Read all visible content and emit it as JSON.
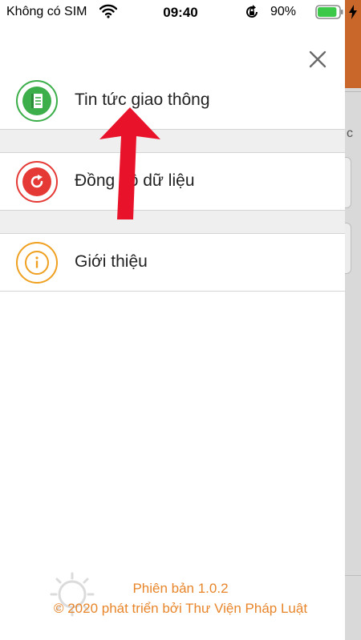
{
  "status_bar": {
    "carrier": "Không có SIM",
    "time": "09:40",
    "battery_percent": "90%",
    "battery_level": 0.9
  },
  "underlay": {
    "partial_char": "c"
  },
  "menu": {
    "items": [
      {
        "label": "Tin tức giao thông",
        "icon": "news-book-icon",
        "color": "#3cae4a"
      },
      {
        "label": "Đồng bộ dữ liệu",
        "icon": "sync-icon",
        "color": "#e53935"
      },
      {
        "label": "Giới thiệu",
        "icon": "info-icon",
        "color": "#f0a020"
      }
    ]
  },
  "footer": {
    "version": "Phiên bản 1.0.2",
    "copyright": "© 2020 phát triển bởi Thư Viện Pháp Luật"
  },
  "colors": {
    "accent": "#e8852a",
    "header_brown": "#c9672a",
    "arrow_red": "#e8122a"
  }
}
